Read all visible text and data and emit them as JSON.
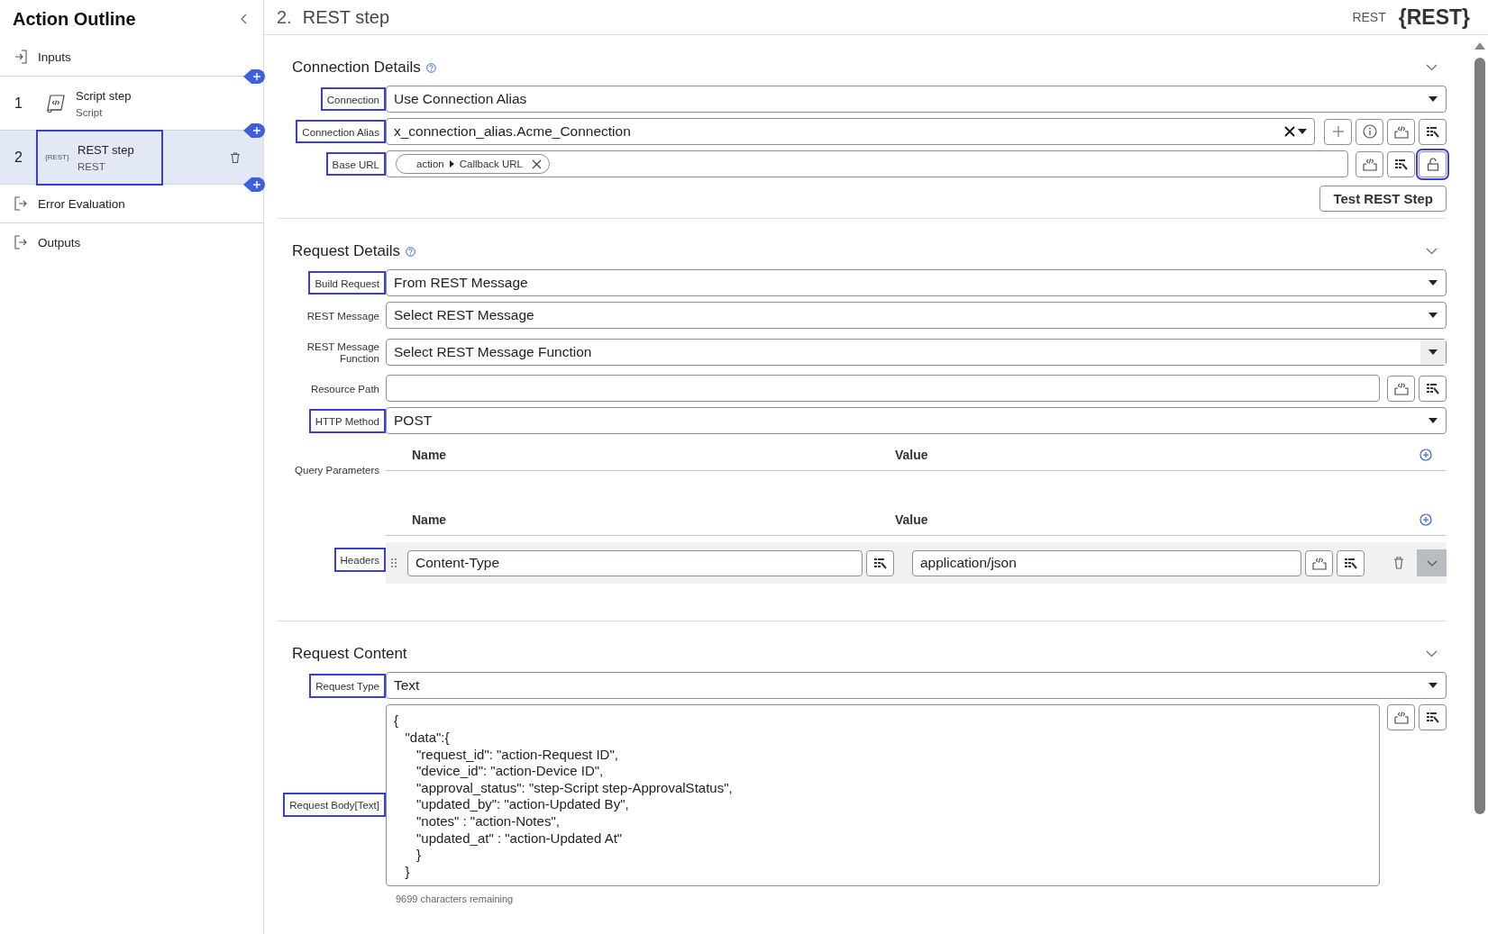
{
  "sidebar": {
    "title": "Action Outline",
    "items": [
      {
        "kind": "io",
        "label": "Inputs",
        "add_after": true
      },
      {
        "kind": "step",
        "number": "1",
        "label": "Script step",
        "sub": "Script",
        "icon": {
          "kind": "script"
        },
        "selected": false,
        "highlighted": false,
        "add_after": true
      },
      {
        "kind": "step",
        "number": "2",
        "label": "REST step",
        "sub": "REST",
        "icon": {
          "kind": "rest",
          "text": "{REST}"
        },
        "selected": true,
        "highlighted": true,
        "add_after": true
      },
      {
        "kind": "io",
        "label": "Error Evaluation",
        "add_after": false
      },
      {
        "kind": "io",
        "label": "Outputs",
        "add_after": false
      }
    ]
  },
  "header": {
    "number": "2.",
    "title": "REST step",
    "type_label": "REST",
    "logo": "{REST}"
  },
  "sections": [
    {
      "title": "Connection Details",
      "help": true,
      "rows": [
        {
          "kind": "select",
          "label": "Connection",
          "highlighted": true,
          "value": "Use Connection Alias",
          "arrow_shaded": false
        },
        {
          "kind": "combo",
          "label": "Connection Alias",
          "highlighted": true,
          "value": "x_connection_alias.Acme_Connection",
          "clearable": true,
          "buttons": [
            {
              "kind": "plus",
              "highlighted": false
            },
            {
              "kind": "info",
              "highlighted": false
            },
            {
              "kind": "script",
              "highlighted": false
            },
            {
              "kind": "picker",
              "highlighted": false
            }
          ]
        },
        {
          "kind": "pills",
          "label": "Base URL",
          "highlighted": true,
          "pills": [
            {
              "source": "action",
              "field": "Callback URL"
            }
          ],
          "buttons": [
            {
              "kind": "script",
              "highlighted": false
            },
            {
              "kind": "picker",
              "highlighted": false
            },
            {
              "kind": "lock",
              "highlighted": true
            }
          ]
        },
        {
          "kind": "actions",
          "buttons": [
            {
              "label": "Test REST Step"
            }
          ]
        }
      ]
    },
    {
      "title": "Request Details",
      "help": true,
      "rows": [
        {
          "kind": "select",
          "label": "Build Request",
          "highlighted": true,
          "value": "From REST Message",
          "arrow_shaded": false
        },
        {
          "kind": "select",
          "label": "REST Message",
          "highlighted": false,
          "value": "Select REST Message",
          "arrow_shaded": false
        },
        {
          "kind": "select",
          "label": "REST Message Function",
          "highlighted": false,
          "value": "Select REST Message Function",
          "arrow_shaded": true
        },
        {
          "kind": "input",
          "label": "Resource Path",
          "highlighted": false,
          "buttons": [
            {
              "kind": "script",
              "highlighted": false
            },
            {
              "kind": "picker",
              "highlighted": false
            }
          ]
        },
        {
          "kind": "select",
          "label": "HTTP Method",
          "highlighted": true,
          "value": "POST",
          "arrow_shaded": false
        },
        {
          "kind": "table",
          "label": "Query Parameters",
          "highlighted": false,
          "columns": [
            "Name",
            "Value"
          ],
          "rows": []
        },
        {
          "kind": "table",
          "label": "Headers",
          "highlighted": true,
          "columns": [
            "Name",
            "Value"
          ],
          "rows": [
            {
              "name": "Content-Type",
              "value": "application/json"
            }
          ]
        }
      ]
    },
    {
      "title": "Request Content",
      "help": false,
      "rows": [
        {
          "kind": "select",
          "label": "Request Type",
          "highlighted": true,
          "value": "Text",
          "arrow_shaded": false
        },
        {
          "kind": "textarea",
          "label": "Request Body[Text]",
          "highlighted": true,
          "value": "{\n   \"data\":{\n      \"request_id\": \"action-Request ID\",\n      \"device_id\": \"action-Device ID\",\n      \"approval_status\": \"step-Script step-ApprovalStatus\",\n      \"updated_by\": \"action-Updated By\",\n      \"notes\" : \"action-Notes\",\n      \"updated_at\" : \"action-Updated At\"\n      }\n   }",
          "counter": "9699 characters remaining",
          "buttons": [
            {
              "kind": "script",
              "highlighted": false
            },
            {
              "kind": "picker",
              "highlighted": false
            }
          ]
        }
      ]
    }
  ]
}
